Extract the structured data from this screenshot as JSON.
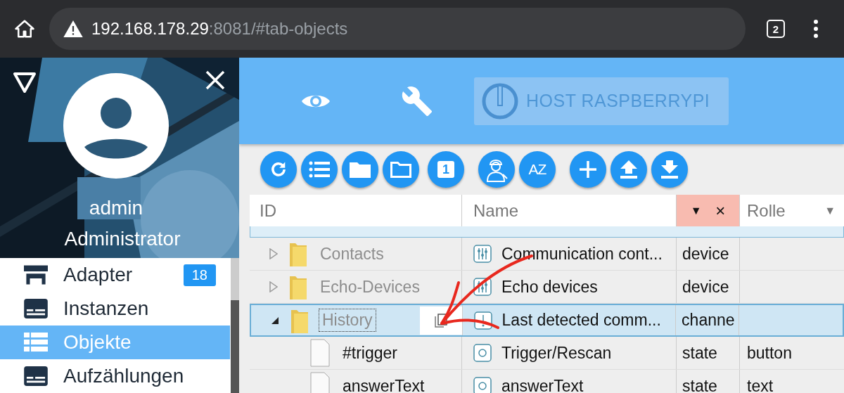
{
  "browser": {
    "url_host": "192.168.178.29",
    "url_rest": ":8081/#tab-objects",
    "tab_count": "2"
  },
  "drawer": {
    "user": "admin",
    "role": "Administrator",
    "menu": [
      {
        "label": "Adapter",
        "badge": "18",
        "selected": false
      },
      {
        "label": "Instanzen",
        "selected": false
      },
      {
        "label": "Objekte",
        "selected": true
      },
      {
        "label": "Aufzählungen",
        "selected": false
      }
    ]
  },
  "header": {
    "host_label": "HOST RASPBERRYPI"
  },
  "toolbar": {
    "page_glyph": "1",
    "sort_glyph": "AZ"
  },
  "table": {
    "columns": [
      {
        "label": "ID"
      },
      {
        "label": "Name"
      },
      {
        "filter": "▼",
        "clear": "×"
      },
      {
        "label": "Rolle",
        "filter": "▼"
      }
    ],
    "rows": [
      {
        "kind": "device",
        "expanded": false,
        "id": "Contacts",
        "name": "Communication cont...",
        "type": "device",
        "selected": false
      },
      {
        "kind": "device",
        "expanded": false,
        "id": "Echo-Devices",
        "name": "Echo devices",
        "type": "device",
        "selected": false
      },
      {
        "kind": "channel",
        "expanded": true,
        "id": "History",
        "name": "Last detected comm...",
        "type": "channe",
        "selected": true
      },
      {
        "kind": "state",
        "id": "#trigger",
        "name": "Trigger/Rescan",
        "type": "state",
        "role": "button",
        "selected": false
      },
      {
        "kind": "state",
        "id": "answerText",
        "name": "answerText",
        "type": "state",
        "role": "text",
        "selected": false
      }
    ]
  }
}
